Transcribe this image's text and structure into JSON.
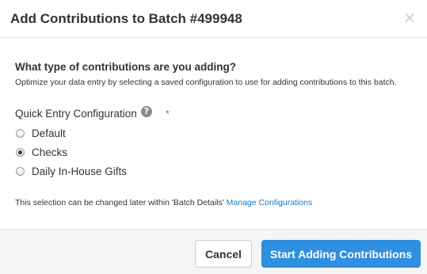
{
  "dialog": {
    "title": "Add Contributions to Batch #499948",
    "close_label": "×"
  },
  "body": {
    "question": "What type of contributions are you adding?",
    "description": "Optimize your data entry by selecting a saved configuration to use for adding contributions to this batch.",
    "field_label": "Quick Entry Configuration",
    "help_icon_glyph": "?",
    "required_marker": "*",
    "options": [
      {
        "label": "Default",
        "checked": false
      },
      {
        "label": "Checks",
        "checked": true
      },
      {
        "label": "Daily In-House Gifts",
        "checked": false
      }
    ],
    "footnote_text": "This selection can be changed later within 'Batch Details'",
    "footnote_link": "Manage Configurations"
  },
  "footer": {
    "cancel_label": "Cancel",
    "primary_label": "Start Adding Contributions"
  },
  "colors": {
    "primary_button": "#2f8fe0",
    "link": "#1a78c2",
    "required": "#d9534f"
  }
}
